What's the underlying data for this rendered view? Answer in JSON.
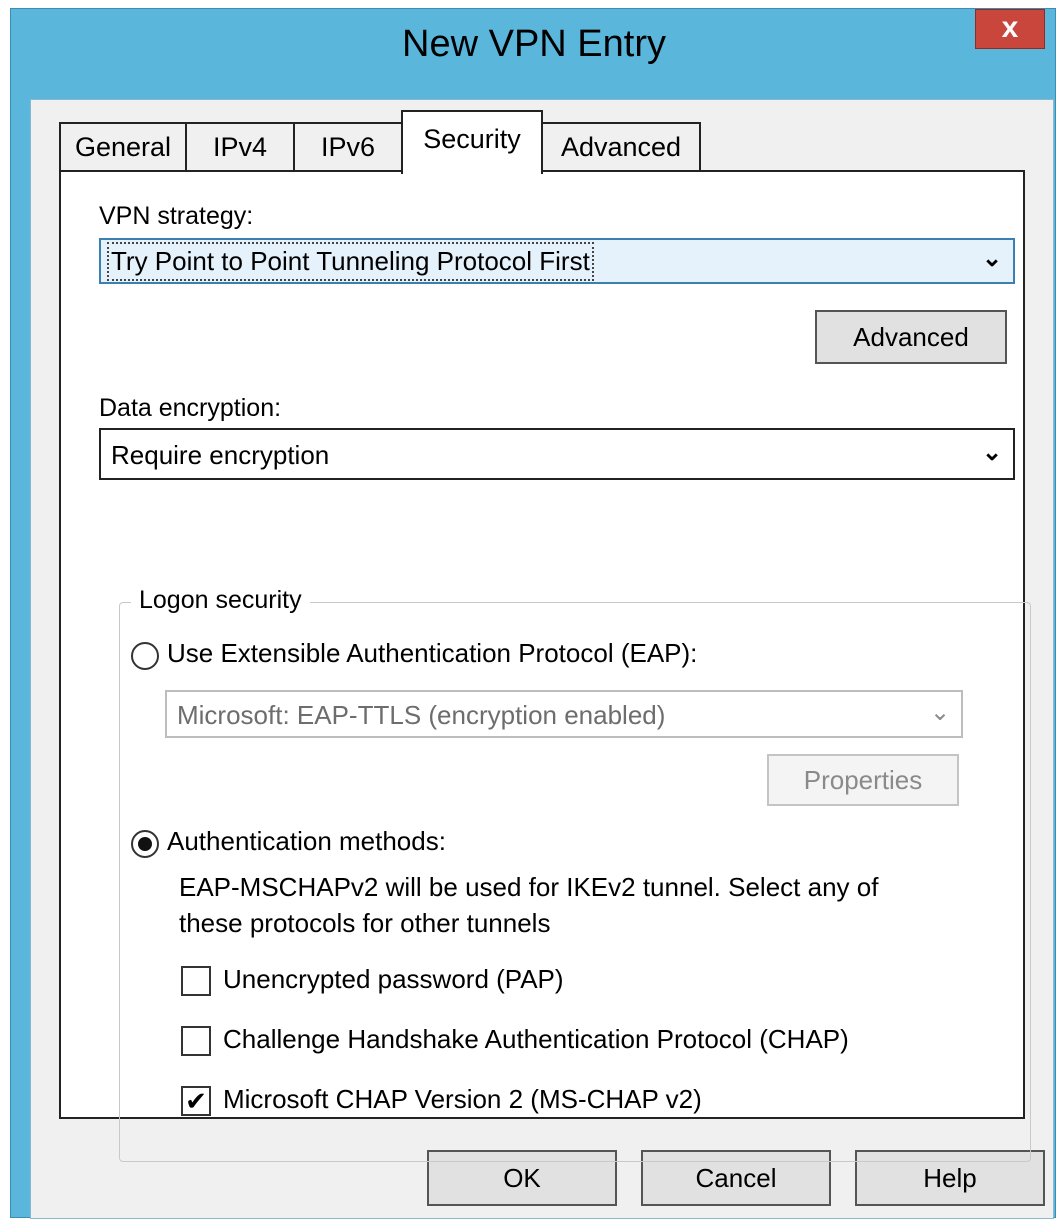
{
  "window": {
    "title": "New VPN Entry",
    "close_glyph": "x"
  },
  "tabs": [
    {
      "label": "General",
      "active": false
    },
    {
      "label": "IPv4",
      "active": false
    },
    {
      "label": "IPv6",
      "active": false
    },
    {
      "label": "Security",
      "active": true
    },
    {
      "label": "Advanced",
      "active": false
    }
  ],
  "security": {
    "vpn_strategy_label": "VPN strategy:",
    "vpn_strategy_value": "Try Point to Point Tunneling Protocol First",
    "advanced_button": "Advanced",
    "data_encryption_label": "Data encryption:",
    "data_encryption_value": "Require encryption",
    "logon_security": {
      "group_label": "Logon security",
      "eap_option": {
        "label": "Use Extensible Authentication Protocol (EAP):",
        "selected": false
      },
      "eap_select_value": "Microsoft: EAP-TTLS (encryption enabled)",
      "properties_button": "Properties",
      "auth_methods_option": {
        "label": "Authentication methods:",
        "selected": true
      },
      "auth_note_line1": "EAP-MSCHAPv2 will be used for IKEv2 tunnel. Select any of",
      "auth_note_line2": "these protocols for other tunnels",
      "methods": [
        {
          "label": "Unencrypted password (PAP)",
          "checked": false
        },
        {
          "label": "Challenge Handshake Authentication Protocol (CHAP)",
          "checked": false
        },
        {
          "label": "Microsoft CHAP Version 2 (MS-CHAP v2)",
          "checked": true
        }
      ]
    }
  },
  "footer": {
    "ok": "OK",
    "cancel": "Cancel",
    "help": "Help"
  },
  "icons": {
    "dropdown": "chevron-down-icon",
    "check": "checkmark-icon"
  },
  "colors": {
    "title_bar": "#5bb6dc",
    "close_button": "#c9463d",
    "focus_border": "#3c7fb1"
  }
}
